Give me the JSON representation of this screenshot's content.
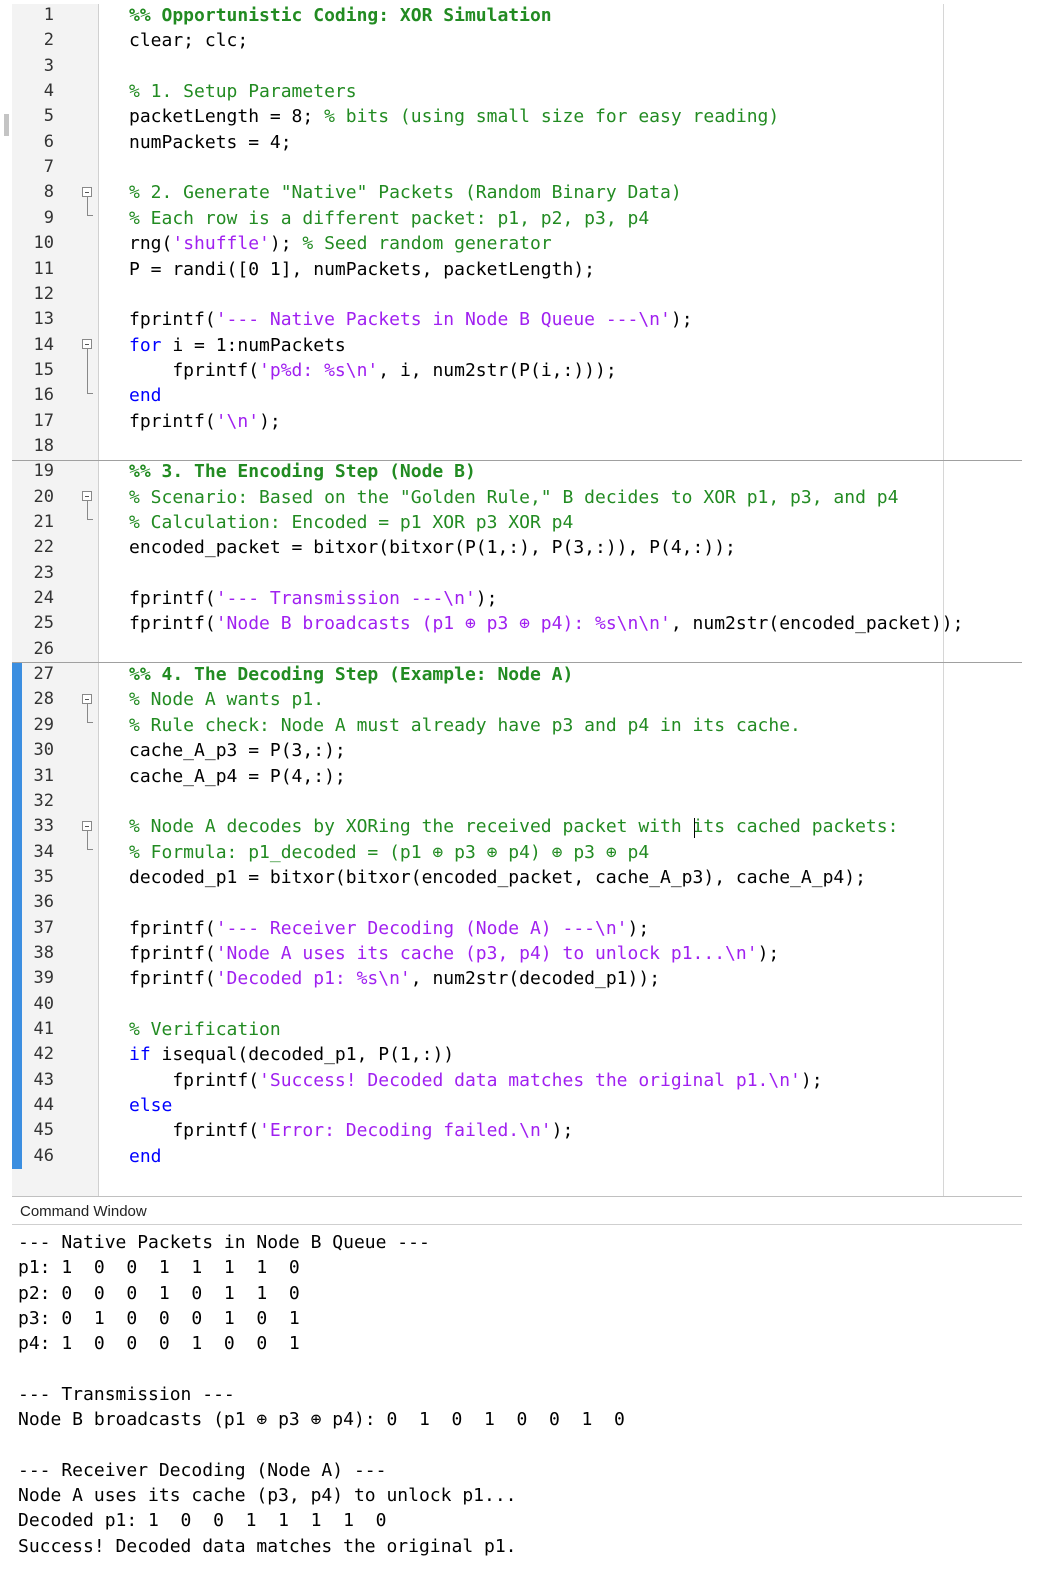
{
  "editor": {
    "lines": [
      {
        "n": "1",
        "segs": [
          {
            "t": "%% Opportunistic Coding: XOR Simulation",
            "c": "cellhead"
          }
        ]
      },
      {
        "n": "2",
        "segs": [
          {
            "t": "clear; clc;",
            "c": ""
          }
        ]
      },
      {
        "n": "3",
        "segs": []
      },
      {
        "n": "4",
        "segs": [
          {
            "t": "% 1. Setup Parameters",
            "c": "comment"
          }
        ]
      },
      {
        "n": "5",
        "segs": [
          {
            "t": "packetLength = 8; ",
            "c": ""
          },
          {
            "t": "% bits (using small size for easy reading)",
            "c": "comment"
          }
        ]
      },
      {
        "n": "6",
        "segs": [
          {
            "t": "numPackets = 4;",
            "c": ""
          }
        ]
      },
      {
        "n": "7",
        "segs": []
      },
      {
        "n": "8",
        "segs": [
          {
            "t": "% 2. Generate \"Native\" Packets (Random Binary Data)",
            "c": "comment"
          }
        ]
      },
      {
        "n": "9",
        "segs": [
          {
            "t": "% Each row is a different packet: p1, p2, p3, p4",
            "c": "comment"
          }
        ]
      },
      {
        "n": "10",
        "segs": [
          {
            "t": "rng(",
            "c": ""
          },
          {
            "t": "'shuffle'",
            "c": "string"
          },
          {
            "t": "); ",
            "c": ""
          },
          {
            "t": "% Seed random generator",
            "c": "comment"
          }
        ]
      },
      {
        "n": "11",
        "segs": [
          {
            "t": "P = randi([0 1], numPackets, packetLength);",
            "c": ""
          }
        ]
      },
      {
        "n": "12",
        "segs": []
      },
      {
        "n": "13",
        "segs": [
          {
            "t": "fprintf(",
            "c": ""
          },
          {
            "t": "'--- Native Packets in Node B Queue ---\\n'",
            "c": "string"
          },
          {
            "t": ");",
            "c": ""
          }
        ]
      },
      {
        "n": "14",
        "segs": [
          {
            "t": "for ",
            "c": "keyword"
          },
          {
            "t": "i = 1:numPackets",
            "c": ""
          }
        ]
      },
      {
        "n": "15",
        "segs": [
          {
            "t": "    fprintf(",
            "c": ""
          },
          {
            "t": "'p%d: %s\\n'",
            "c": "string"
          },
          {
            "t": ", i, num2str(P(i,:)));",
            "c": ""
          }
        ]
      },
      {
        "n": "16",
        "segs": [
          {
            "t": "end",
            "c": "keyword"
          }
        ]
      },
      {
        "n": "17",
        "segs": [
          {
            "t": "fprintf(",
            "c": ""
          },
          {
            "t": "'\\n'",
            "c": "string"
          },
          {
            "t": ");",
            "c": ""
          }
        ]
      },
      {
        "n": "18",
        "segs": []
      },
      {
        "n": "19",
        "segs": [
          {
            "t": "%% 3. The Encoding Step (Node B)",
            "c": "cellhead"
          }
        ]
      },
      {
        "n": "20",
        "segs": [
          {
            "t": "% Scenario: Based on the \"Golden Rule,\" B decides to XOR p1, p3, and p4",
            "c": "comment"
          }
        ]
      },
      {
        "n": "21",
        "segs": [
          {
            "t": "% Calculation: Encoded = p1 XOR p3 XOR p4",
            "c": "comment"
          }
        ]
      },
      {
        "n": "22",
        "segs": [
          {
            "t": "encoded_packet = bitxor(bitxor(P(1,:), P(3,:)), P(4,:));",
            "c": ""
          }
        ]
      },
      {
        "n": "23",
        "segs": []
      },
      {
        "n": "24",
        "segs": [
          {
            "t": "fprintf(",
            "c": ""
          },
          {
            "t": "'--- Transmission ---\\n'",
            "c": "string"
          },
          {
            "t": ");",
            "c": ""
          }
        ]
      },
      {
        "n": "25",
        "segs": [
          {
            "t": "fprintf(",
            "c": ""
          },
          {
            "t": "'Node B broadcasts (p1 ⊕ p3 ⊕ p4): %s\\n\\n'",
            "c": "string"
          },
          {
            "t": ", num2str(encoded_packet));",
            "c": ""
          }
        ]
      },
      {
        "n": "26",
        "segs": []
      },
      {
        "n": "27",
        "segs": [
          {
            "t": "%% 4. The Decoding Step (Example: Node A)",
            "c": "cellhead"
          }
        ]
      },
      {
        "n": "28",
        "segs": [
          {
            "t": "% Node A wants p1.",
            "c": "comment"
          }
        ]
      },
      {
        "n": "29",
        "segs": [
          {
            "t": "% Rule check: Node A must already have p3 and p4 in its cache.",
            "c": "comment"
          }
        ]
      },
      {
        "n": "30",
        "segs": [
          {
            "t": "cache_A_p3 = P(3,:);",
            "c": ""
          }
        ]
      },
      {
        "n": "31",
        "segs": [
          {
            "t": "cache_A_p4 = P(4,:);",
            "c": ""
          }
        ]
      },
      {
        "n": "32",
        "segs": []
      },
      {
        "n": "33",
        "segs": [
          {
            "t": "% Node A decodes by XORing the received packet with its cached packets:",
            "c": "comment"
          }
        ]
      },
      {
        "n": "34",
        "segs": [
          {
            "t": "% Formula: p1_decoded = (p1 ⊕ p3 ⊕ p4) ⊕ p3 ⊕ p4",
            "c": "comment"
          }
        ]
      },
      {
        "n": "35",
        "segs": [
          {
            "t": "decoded_p1 = bitxor(bitxor(encoded_packet, cache_A_p3), cache_A_p4);",
            "c": ""
          }
        ]
      },
      {
        "n": "36",
        "segs": []
      },
      {
        "n": "37",
        "segs": [
          {
            "t": "fprintf(",
            "c": ""
          },
          {
            "t": "'--- Receiver Decoding (Node A) ---\\n'",
            "c": "string"
          },
          {
            "t": ");",
            "c": ""
          }
        ]
      },
      {
        "n": "38",
        "segs": [
          {
            "t": "fprintf(",
            "c": ""
          },
          {
            "t": "'Node A uses its cache (p3, p4) to unlock p1...\\n'",
            "c": "string"
          },
          {
            "t": ");",
            "c": ""
          }
        ]
      },
      {
        "n": "39",
        "segs": [
          {
            "t": "fprintf(",
            "c": ""
          },
          {
            "t": "'Decoded p1: %s\\n'",
            "c": "string"
          },
          {
            "t": ", num2str(decoded_p1));",
            "c": ""
          }
        ]
      },
      {
        "n": "40",
        "segs": []
      },
      {
        "n": "41",
        "segs": [
          {
            "t": "% Verification",
            "c": "comment"
          }
        ]
      },
      {
        "n": "42",
        "segs": [
          {
            "t": "if ",
            "c": "keyword"
          },
          {
            "t": "isequal(decoded_p1, P(1,:))",
            "c": ""
          }
        ]
      },
      {
        "n": "43",
        "segs": [
          {
            "t": "    fprintf(",
            "c": ""
          },
          {
            "t": "'Success! Decoded data matches the original p1.\\n'",
            "c": "string"
          },
          {
            "t": ");",
            "c": ""
          }
        ]
      },
      {
        "n": "44",
        "segs": [
          {
            "t": "else",
            "c": "keyword"
          }
        ]
      },
      {
        "n": "45",
        "segs": [
          {
            "t": "    fprintf(",
            "c": ""
          },
          {
            "t": "'Error: Decoding failed.\\n'",
            "c": "string"
          },
          {
            "t": ");",
            "c": ""
          }
        ]
      },
      {
        "n": "46",
        "segs": [
          {
            "t": "end",
            "c": "keyword"
          }
        ]
      }
    ]
  },
  "command_window": {
    "title": "Command Window",
    "output": [
      "--- Native Packets in Node B Queue ---",
      "p1: 1  0  0  1  1  1  1  0",
      "p2: 0  0  0  1  0  1  1  0",
      "p3: 0  1  0  0  0  1  0  1",
      "p4: 1  0  0  0  1  0  0  1",
      "",
      "--- Transmission ---",
      "Node B broadcasts (p1 ⊕ p3 ⊕ p4): 0  1  0  1  0  0  1  0",
      "",
      "--- Receiver Decoding (Node A) ---",
      "Node A uses its cache (p3, p4) to unlock p1...",
      "Decoded p1: 1  0  0  1  1  1  1  0",
      "Success! Decoded data matches the original p1."
    ]
  },
  "colors": {
    "comment": "#228b22",
    "string": "#a020f0",
    "keyword": "#0000ff",
    "cell_bar": "#3b8ee0"
  }
}
